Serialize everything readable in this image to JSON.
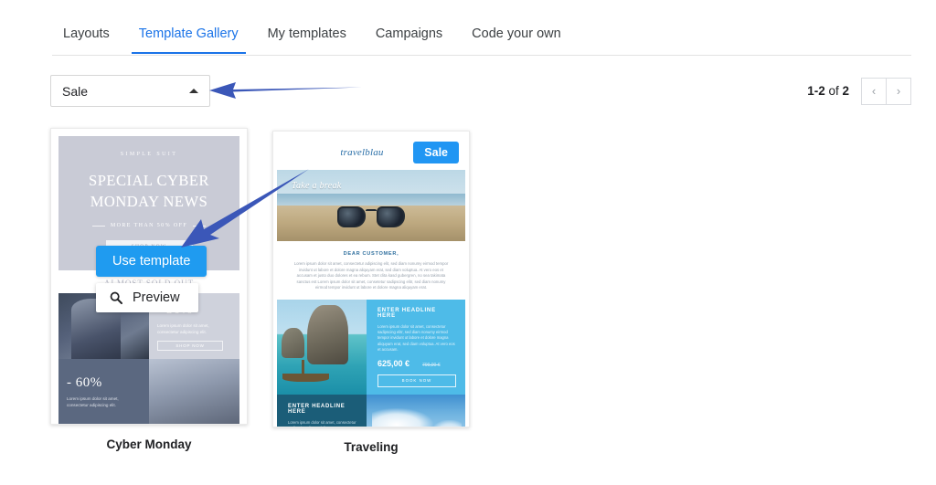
{
  "tabs": [
    {
      "label": "Layouts",
      "active": false
    },
    {
      "label": "Template Gallery",
      "active": true
    },
    {
      "label": "My templates",
      "active": false
    },
    {
      "label": "Campaigns",
      "active": false
    },
    {
      "label": "Code your own",
      "active": false
    }
  ],
  "filter": {
    "selected": "Sale",
    "chevron_icon": "chevron-up-icon"
  },
  "pagination": {
    "range": "1-2",
    "of_label": " of ",
    "total": "2",
    "prev_icon": "chevron-left-icon",
    "next_icon": "chevron-right-icon",
    "prev_glyph": "‹",
    "next_glyph": "›"
  },
  "overlay": {
    "use_template_label": "Use template",
    "preview_label": "Preview",
    "preview_icon": "search-icon",
    "accent_color": "#1f9bf0"
  },
  "annotations": {
    "arrow_color": "#3b57b8",
    "arrow_1_target": "filter-select",
    "arrow_2_target": "use-template-button"
  },
  "cards": [
    {
      "title": "Cyber Monday",
      "preview": {
        "brand": "SIMPLE SUIT",
        "headline": "SPECIAL CYBER MONDAY NEWS",
        "subhead": "MORE THAN 50% OFF",
        "cta": "SHOP NOW",
        "section_label": "ALMOST SOLD OUT",
        "cells": [
          {
            "discount": "- 50%",
            "body": "Lorem ipsum dolor sit amet, consectetur adipiscing elit.",
            "button": "SHOP NOW"
          },
          {
            "discount": "- 60%",
            "body": "Lorem ipsum dolor sit amet, consectetur adipiscing elit."
          }
        ]
      }
    },
    {
      "title": "Traveling",
      "preview": {
        "logo": "travelblau",
        "badge": "Sale",
        "hero_text": "Take a break",
        "greeting": "DEAR CUSTOMER,",
        "body": "Lorem ipsum dolor sit amet, consectetur adipiscing elit, sed diam nonumy eirmod tempor invidunt ut labore et dolore magna aliquyam erat, sed diam voluptua. At vero eos et accusam et justo duo dolores et ea rebum. Stet clita kasd gubergren, no sea takimata sanctus est Lorem ipsum dolor sit amet, consetetur sadipscing elitr, sed diam nonumy eirmod tempor invidunt ut labore et dolore magna aliquyam erat.",
        "promo_headline": "ENTER HEADLINE HERE",
        "promo_body": "Lorem ipsum dolor sit amet, consectetur sadipscing elitr, sed diam nonumy eirmod tempor invidunt ut labore et dolore magna aliquyam erat, sed diam voluptua. At vero eos et accusam.",
        "price": "625,00 €",
        "old_price": "799,00 €",
        "book_button": "BOOK NOW",
        "bottom_headline": "ENTER HEADLINE HERE",
        "bottom_body": "Lorem ipsum dolor sit amet, consectetur sadipscing elitr, sed diam nonumy eirmod."
      }
    }
  ]
}
